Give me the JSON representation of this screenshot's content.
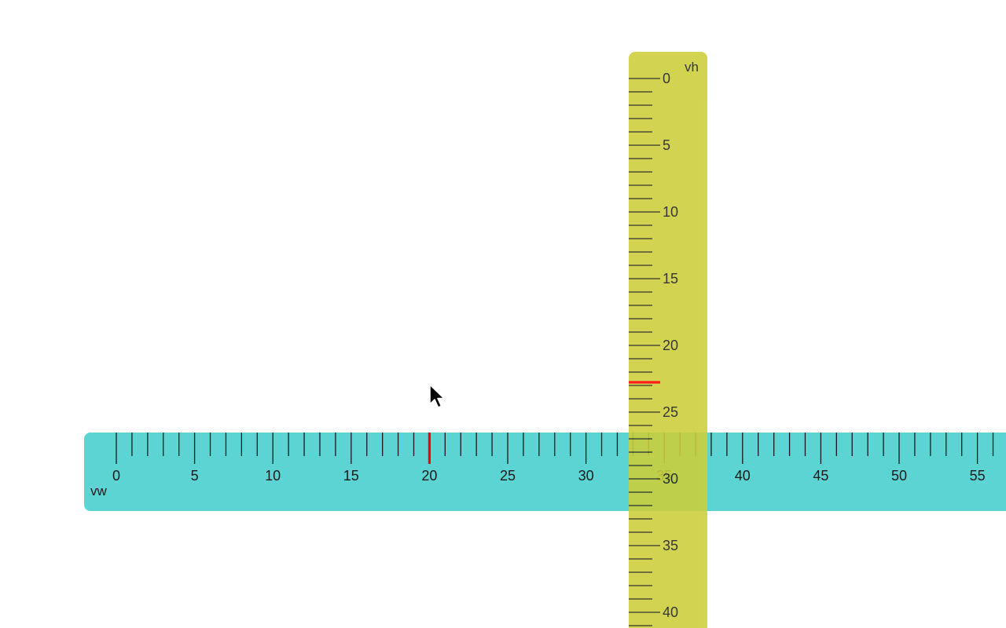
{
  "horizontal_ruler": {
    "unit_label": "vw",
    "color": "#5bd4d3",
    "tick_labels": [
      "0",
      "5",
      "10",
      "15",
      "20",
      "25",
      "30",
      "35",
      "40",
      "45",
      "50",
      "55"
    ],
    "minor_ticks_per_label": 5,
    "position_marker_value": 20,
    "marker_color": "#ff0000"
  },
  "vertical_ruler": {
    "unit_label": "vh",
    "color": "#cccf3a",
    "tick_labels": [
      "0",
      "5",
      "10",
      "15",
      "20",
      "25",
      "30",
      "35",
      "40"
    ],
    "minor_ticks_per_label": 5,
    "position_marker_value": 23,
    "marker_color": "#ff0000"
  },
  "cursor": {
    "icon": "arrow-pointer-icon"
  }
}
